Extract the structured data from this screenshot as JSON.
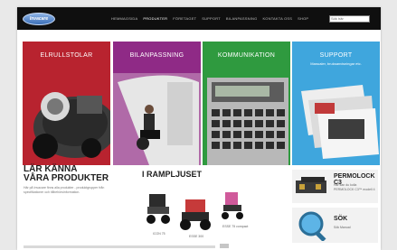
{
  "brand": {
    "logo_text": "Invacare"
  },
  "nav": {
    "items": [
      "HEMMAGSIDA",
      "PRODUKTER",
      "FÖRETAGET",
      "SUPPORT",
      "BILANPASSNING",
      "KONTAKTA OSS",
      "SHOP"
    ],
    "active_index": 1
  },
  "search": {
    "placeholder": "Sök här"
  },
  "tiles": [
    {
      "title": "ELRULLSTOLAR",
      "color": "#b8232f"
    },
    {
      "title": "BILANPASSNING",
      "color": "#8f2a86"
    },
    {
      "title": "KOMMUNIKATION",
      "color": "#2f9a3f"
    },
    {
      "title": "SUPPORT",
      "subtitle": "Manualer, bruksanvisningar etc.",
      "color": "#3fa6dd"
    }
  ],
  "intro": {
    "title_line1": "LÄR KÄNNA",
    "title_line2": "VÅRA PRODUKTER",
    "body": "Här på Invacare finns alla produkter - produktgrupper från specifikationer och tillbehörsinformation."
  },
  "spotlight": {
    "title": "I RAMPLJUSET",
    "products": [
      "ICON 75",
      "ESSE 300",
      "ESSE 75 compact"
    ]
  },
  "promo": {
    "title": "PERMOLOCK C3",
    "subtitle": "Här kan du kolla PERMOLOCK C3™ modell 4"
  },
  "search_box": {
    "title": "SÖK",
    "subtitle": "Sök Manual"
  }
}
